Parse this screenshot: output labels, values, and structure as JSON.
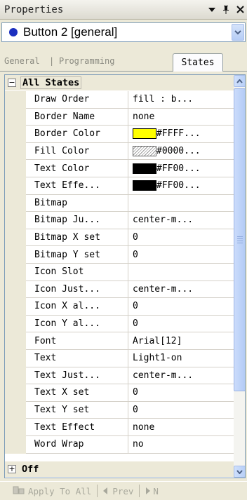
{
  "titlebar": {
    "title": "Properties",
    "dropdown_glyph": "▾",
    "pin_glyph": "ᵠ",
    "close_glyph": "✕"
  },
  "object_selector": {
    "value": "Button 2  [general]",
    "dot_color": "#1b2fbf"
  },
  "tabs": [
    {
      "label": "General",
      "active": false
    },
    {
      "label": "Programming",
      "active": false
    },
    {
      "label": "States",
      "active": true
    }
  ],
  "tab_separator": "|",
  "grid": {
    "category": {
      "label": "All States",
      "expander": "−"
    },
    "properties": [
      {
        "name": "Draw Order",
        "value": "fill : b..."
      },
      {
        "name": "Border Name",
        "value": "none"
      },
      {
        "name": "Border Color",
        "value": "#FFFF...",
        "swatch": "#ffff00"
      },
      {
        "name": "Fill Color",
        "value": "#0000...",
        "swatch": "hatch"
      },
      {
        "name": "Text Color",
        "value": "#FF00...",
        "swatch": "#000000"
      },
      {
        "name": "Text Effe...",
        "value": "#FF00...",
        "swatch": "#000000"
      },
      {
        "name": "Bitmap",
        "value": ""
      },
      {
        "name": "Bitmap Ju...",
        "value": "center-m..."
      },
      {
        "name": "Bitmap X set",
        "value": "0"
      },
      {
        "name": "Bitmap Y set",
        "value": "0"
      },
      {
        "name": "Icon Slot",
        "value": ""
      },
      {
        "name": "Icon Just...",
        "value": "center-m..."
      },
      {
        "name": "Icon X al...",
        "value": "0"
      },
      {
        "name": "Icon Y al...",
        "value": "0"
      },
      {
        "name": "Font",
        "value": "Arial[12]"
      },
      {
        "name": "Text",
        "value": "Light1-on"
      },
      {
        "name": "Text Just...",
        "value": "center-m..."
      },
      {
        "name": "Text X set",
        "value": "0"
      },
      {
        "name": "Text Y set",
        "value": "0"
      },
      {
        "name": "Text Effect",
        "value": "none"
      },
      {
        "name": "Word Wrap",
        "value": "no"
      }
    ],
    "collapsed_category": {
      "label": "Off",
      "expander": "+"
    }
  },
  "footer": {
    "apply_label": "Apply To All",
    "prev_label": "Prev",
    "next_label": "N"
  }
}
